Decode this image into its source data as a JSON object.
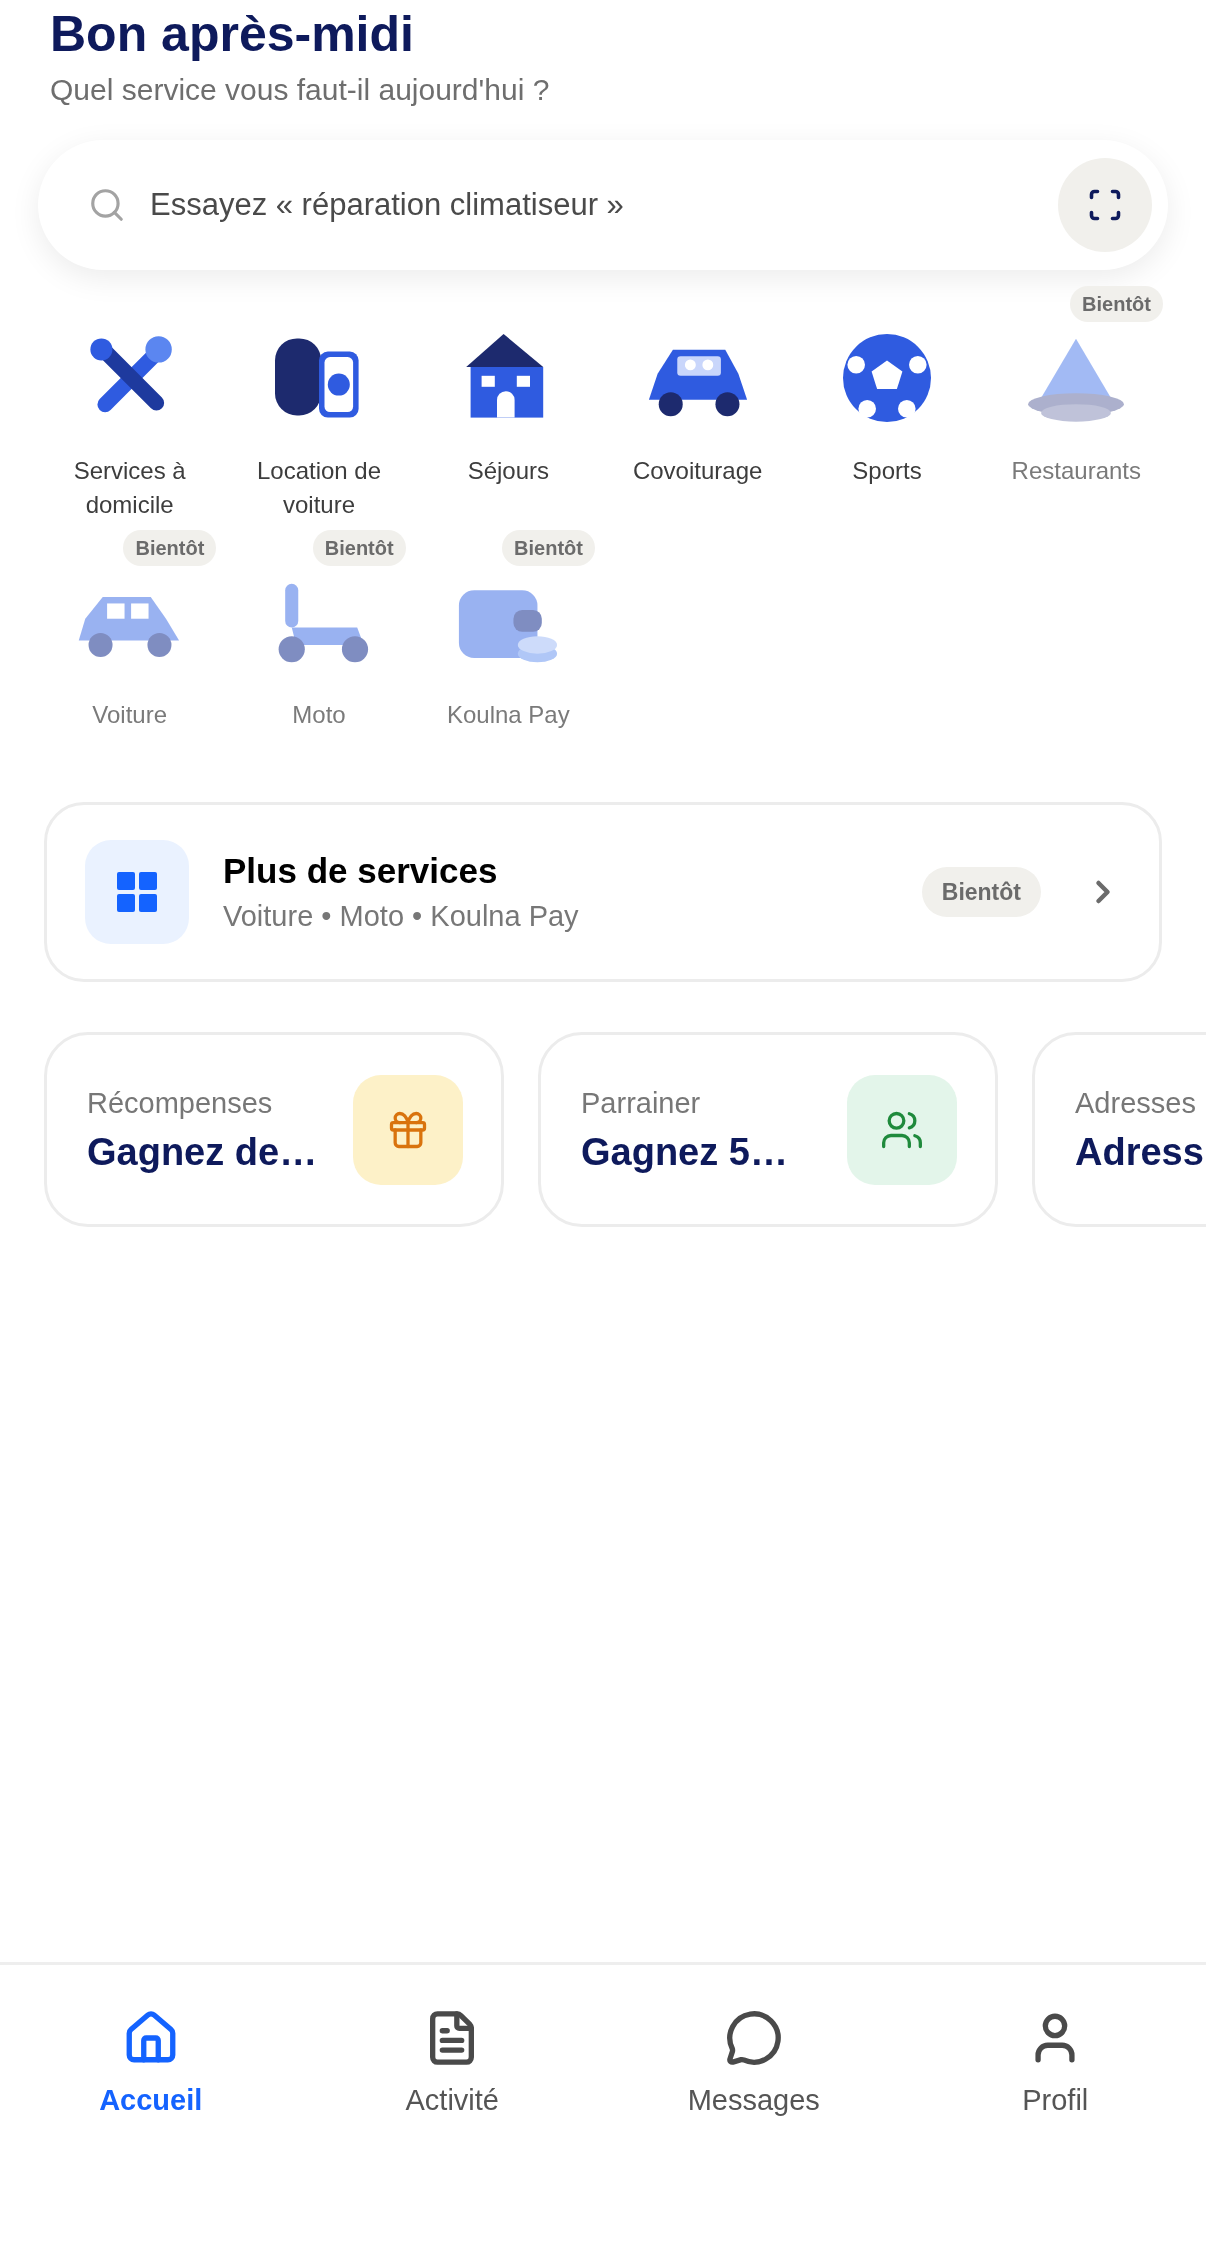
{
  "header": {
    "title": "Bon après-midi",
    "subtitle": "Quel service vous faut-il aujourd'hui ?"
  },
  "search": {
    "placeholder": "Essayez « réparation climatiseur »"
  },
  "services": [
    {
      "kind": "tools",
      "label": "Services à domicile",
      "disabled": false
    },
    {
      "kind": "key",
      "label": "Location de voiture",
      "disabled": false
    },
    {
      "kind": "house",
      "label": "Séjours",
      "disabled": false
    },
    {
      "kind": "carpool",
      "label": "Covoiturage",
      "disabled": false
    },
    {
      "kind": "ball",
      "label": "Sports",
      "disabled": false
    },
    {
      "kind": "tagine",
      "label": "Restaurants",
      "disabled": true,
      "badge": "Bientôt"
    },
    {
      "kind": "car",
      "label": "Voiture",
      "disabled": true,
      "badge": "Bientôt"
    },
    {
      "kind": "scooter",
      "label": "Moto",
      "disabled": true,
      "badge": "Bientôt"
    },
    {
      "kind": "wallet",
      "label": "Koulna Pay",
      "disabled": true,
      "badge": "Bientôt"
    }
  ],
  "more_services": {
    "title": "Plus de services",
    "subtitle": "Voiture • Moto • Koulna Pay",
    "badge": "Bientôt"
  },
  "cards": [
    {
      "kind": "gift",
      "label": "Récompenses",
      "value": "Gagnez de…"
    },
    {
      "kind": "people",
      "label": "Parrainer",
      "value": "Gagnez 5…"
    },
    {
      "kind": "none",
      "label": "Adresses",
      "value": "Adress"
    }
  ],
  "tabs": [
    {
      "kind": "home",
      "label": "Accueil",
      "selected": true
    },
    {
      "kind": "doc",
      "label": "Activité",
      "selected": false
    },
    {
      "kind": "chat",
      "label": "Messages",
      "selected": false
    },
    {
      "kind": "user",
      "label": "Profil",
      "selected": false
    }
  ]
}
